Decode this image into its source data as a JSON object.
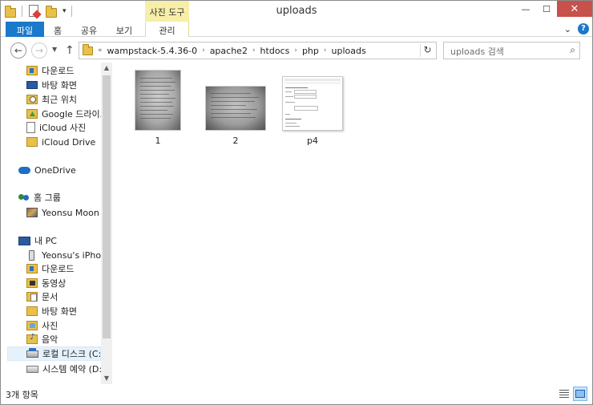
{
  "window": {
    "title": "uploads",
    "contextual_tab_group": "사진 도구",
    "buttons": {
      "minimize": "—",
      "maximize": "☐",
      "close": "✕"
    }
  },
  "ribbon": {
    "tabs": [
      {
        "label": "파일"
      },
      {
        "label": "홈"
      },
      {
        "label": "공유"
      },
      {
        "label": "보기"
      },
      {
        "label": "관리"
      }
    ],
    "expand_glyph": "⌄",
    "help_glyph": "?"
  },
  "navigation": {
    "back_glyph": "←",
    "forward_glyph": "→",
    "recent_glyph": "▼",
    "up_glyph": "↑"
  },
  "address": {
    "overflow": "«",
    "crumbs": [
      "wampstack-5.4.36-0",
      "apache2",
      "htdocs",
      "php",
      "uploads"
    ],
    "separator": "›",
    "refresh_glyph": "↻"
  },
  "search": {
    "placeholder": "uploads 검색",
    "icon_glyph": "⌕"
  },
  "nav_pane": {
    "items": [
      {
        "label": "다운로드",
        "icon": "downloads-folder-icon"
      },
      {
        "label": "바탕 화면",
        "icon": "desktop-icon"
      },
      {
        "label": "최근 위치",
        "icon": "recent-places-icon"
      },
      {
        "label": "Google 드라이브",
        "icon": "google-drive-icon"
      },
      {
        "label": "iCloud 사진",
        "icon": "icloud-photos-icon"
      },
      {
        "label": "iCloud Drive",
        "icon": "icloud-drive-icon"
      },
      {
        "label": "OneDrive",
        "icon": "onedrive-icon"
      },
      {
        "label": "홈 그룹",
        "icon": "homegroup-icon"
      },
      {
        "label": "Yeonsu Moon",
        "icon": "user-avatar-icon"
      },
      {
        "label": "내 PC",
        "icon": "this-pc-icon"
      },
      {
        "label": "Yeonsu's iPhone",
        "icon": "iphone-icon"
      },
      {
        "label": "다운로드",
        "icon": "downloads-folder-icon"
      },
      {
        "label": "동영상",
        "icon": "videos-folder-icon"
      },
      {
        "label": "문서",
        "icon": "documents-folder-icon"
      },
      {
        "label": "바탕 화면",
        "icon": "desktop-folder-icon"
      },
      {
        "label": "사진",
        "icon": "pictures-folder-icon"
      },
      {
        "label": "음악",
        "icon": "music-folder-icon"
      },
      {
        "label": "로컬 디스크 (C:)",
        "icon": "local-disk-icon"
      },
      {
        "label": "시스템 예약 (D:)",
        "icon": "system-reserved-disk-icon"
      }
    ],
    "selected_index": 17,
    "scroll_up_glyph": "▲",
    "scroll_down_glyph": "▼"
  },
  "files": [
    {
      "name": "1",
      "type": "photo-thumbnail"
    },
    {
      "name": "2",
      "type": "photo-thumbnail"
    },
    {
      "name": "p4",
      "type": "webpage-thumbnail"
    }
  ],
  "status": {
    "item_count": "3개 항목"
  },
  "colors": {
    "accent": "#1979ca",
    "contextual_tab": "#f7eea8",
    "close_button": "#c7514b"
  }
}
